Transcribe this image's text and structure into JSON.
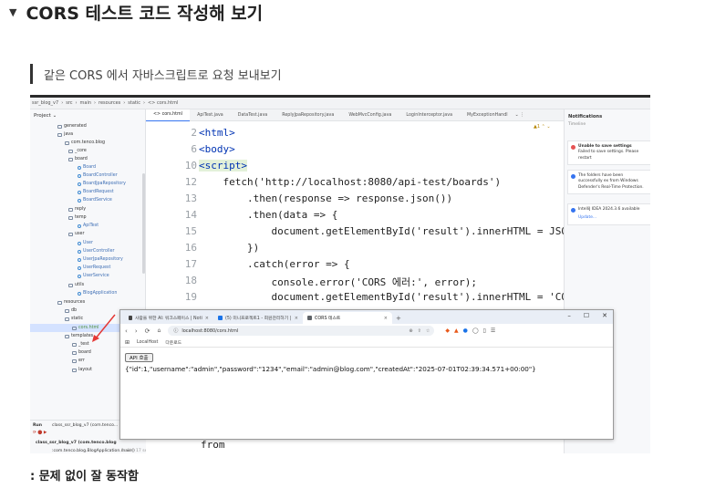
{
  "heading": {
    "marker": "▼",
    "text": "CORS 테스트 코드 작성해 보기"
  },
  "quote": {
    "text": "같은 CORS 에서 자바스크립트로 요청 보내보기"
  },
  "ide": {
    "breadcrumb": [
      "ssr_blog_v7",
      "›",
      "src",
      "›",
      "main",
      "›",
      "resources",
      "›",
      "static",
      "›",
      "<> cors.html"
    ],
    "project_label": "Project ⌄",
    "tree": [
      {
        "label": "generated",
        "kind": "folder"
      },
      {
        "label": "java",
        "kind": "folder"
      },
      {
        "label": "com.tenco.blog",
        "kind": "folder"
      },
      {
        "label": "_core",
        "kind": "folder"
      },
      {
        "label": "board",
        "kind": "folder"
      },
      {
        "label": "Board",
        "kind": "class"
      },
      {
        "label": "BoardController",
        "kind": "class"
      },
      {
        "label": "BoardJpaRepository",
        "kind": "class"
      },
      {
        "label": "BoardRequest",
        "kind": "class"
      },
      {
        "label": "BoardService",
        "kind": "class"
      },
      {
        "label": "reply",
        "kind": "folder"
      },
      {
        "label": "temp",
        "kind": "folder"
      },
      {
        "label": "ApiTest",
        "kind": "class"
      },
      {
        "label": "user",
        "kind": "folder"
      },
      {
        "label": "User",
        "kind": "class"
      },
      {
        "label": "UserController",
        "kind": "class"
      },
      {
        "label": "UserJpaRepository",
        "kind": "class"
      },
      {
        "label": "UserRequest",
        "kind": "class"
      },
      {
        "label": "UserService",
        "kind": "class"
      },
      {
        "label": "utils",
        "kind": "folder"
      },
      {
        "label": "BlogApplication",
        "kind": "class"
      },
      {
        "label": "resources",
        "kind": "folder"
      },
      {
        "label": "db",
        "kind": "folder"
      },
      {
        "label": "static",
        "kind": "folder"
      },
      {
        "label": "cors.html",
        "kind": "file"
      },
      {
        "label": "templates",
        "kind": "folder"
      },
      {
        "label": "_test",
        "kind": "folder"
      },
      {
        "label": "board",
        "kind": "folder"
      },
      {
        "label": "err",
        "kind": "folder"
      },
      {
        "label": "layout",
        "kind": "folder"
      }
    ],
    "run": {
      "label": "Run",
      "config": "class_ssr_blog_v7 (com.tenco...",
      "line1": "class_ssr_blog_v7 (com.tenco.blog",
      "line1_time": "",
      "line2": ":com.tenco.blog.BlogApplication.main()",
      "line2_time": "1 min, 17 sec"
    },
    "tabs": [
      "<> cors.html",
      "ApiTest.java",
      "DataTest.java",
      "ReplyJpaRepository.java",
      "WebMvcConfig.java",
      "LoginInterceptor.java",
      "MyExceptionHandl"
    ],
    "tabs_more": "⌄  ⋮",
    "warning": "▲1 ⌃ ⌄",
    "line_numbers": [
      "2",
      "6",
      "10",
      "12",
      "13",
      "14",
      "15",
      "16",
      "17",
      "18",
      "19"
    ],
    "code_lines": [
      "<html>",
      "<body>",
      "<script>",
      "    fetch('http://localhost:8080/api-test/boards')",
      "        .then(response => response.json())",
      "        .then(data => {",
      "            document.getElementById('result').innerHTML = JSON.s",
      "        })",
      "        .catch(error => {",
      "            console.error('CORS 에러:', error);",
      "            document.getElementById('result').innerHTML = 'CORS"
    ],
    "code_tail": "from",
    "notifications": {
      "title": "Notifications",
      "timeline": "Timeline",
      "items": [
        {
          "title": "Unable to save settings",
          "body": "Failed to save settings. Please restart",
          "color": "#e55353"
        },
        {
          "title": "",
          "body": "The folders have been successfully ex from Windows Defender's Real-Time Protection.",
          "color": "#3574f0"
        },
        {
          "title": "",
          "body": "IntelliJ IDEA 2024.3.6 available",
          "link": "Update...",
          "color": "#3574f0"
        }
      ]
    }
  },
  "browser": {
    "tabs": [
      {
        "label": "사람을 위한 AI: 워크스페이스 | Noti",
        "color": "#444444"
      },
      {
        "label": "(5) 미니프로젝트1 - 회원관리하기 |",
        "color": "#1a73e8"
      },
      {
        "label": "CORS 테스트",
        "color": "#5f6368"
      }
    ],
    "newtab": "+",
    "controls": [
      "–",
      "☐",
      "✕"
    ],
    "url": "localhost:8080/cors.html",
    "bookmarks": [
      "LocalHost",
      "다운로드"
    ],
    "api_button": "API 호출",
    "result": "{\"id\":1,\"username\":\"admin\",\"password\":\"1234\",\"email\":\"admin@blog.com\",\"createdAt\":\"2025-07-01T02:39:34.571+00:00\"}"
  },
  "footer": ": 문제 없이 잘 동작함",
  "colors": {
    "accent": "#3574f0",
    "arrow": "#e53935",
    "selection": "#d4e2ff"
  }
}
